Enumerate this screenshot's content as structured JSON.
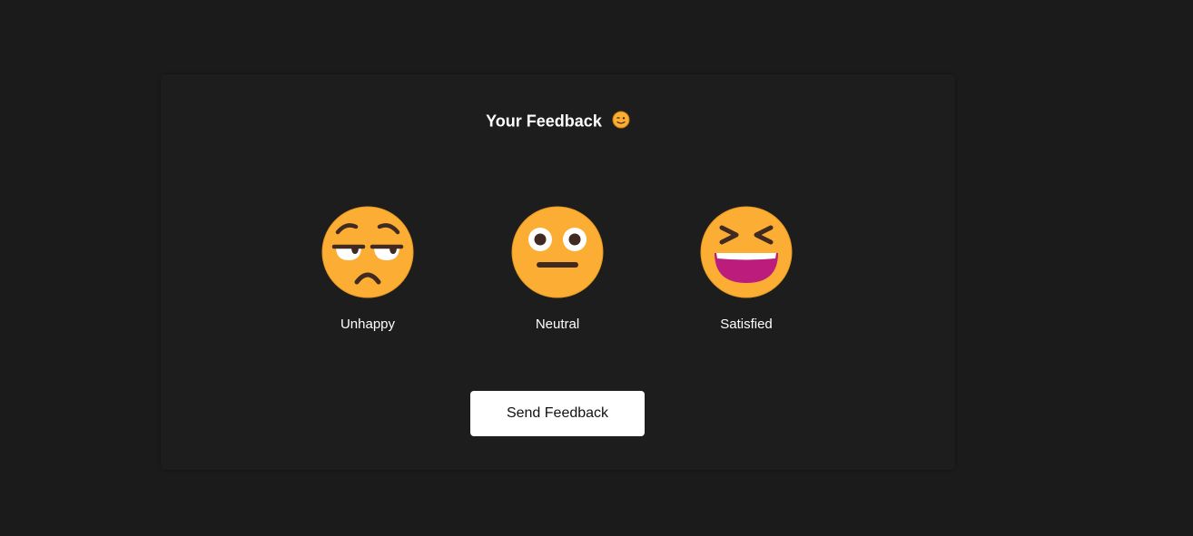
{
  "feedback": {
    "title": "Your Feedback",
    "title_icon": "smiling-face-icon",
    "options": [
      {
        "label": "Unhappy",
        "icon": "unamused-face-icon"
      },
      {
        "label": "Neutral",
        "icon": "neutral-face-icon"
      },
      {
        "label": "Satisfied",
        "icon": "grinning-squinting-face-icon"
      }
    ],
    "send_label": "Send Feedback"
  },
  "colors": {
    "background": "#1b1b1b",
    "card": "#1d1d1d",
    "face": "#fcad33",
    "button": "#ffffff"
  }
}
